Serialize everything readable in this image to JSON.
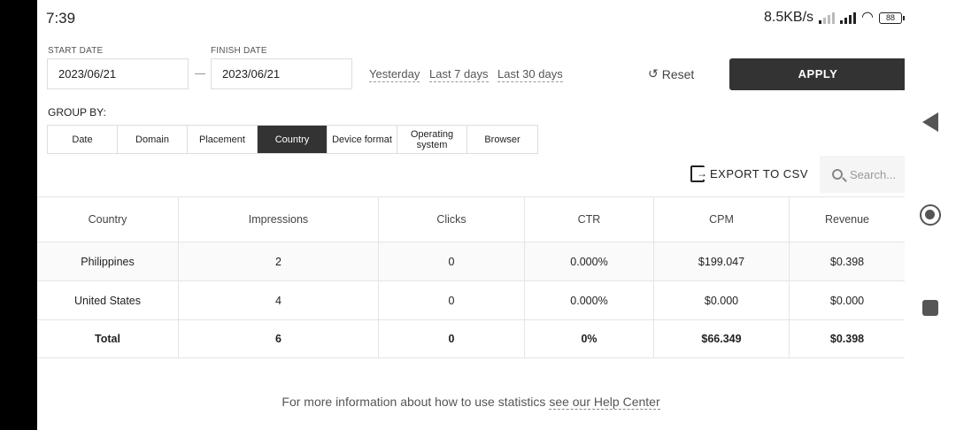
{
  "status_bar": {
    "time": "7:39",
    "network_speed": "8.5KB/s",
    "battery": "88"
  },
  "filters": {
    "start_label": "START DATE",
    "start_value": "2023/06/21",
    "finish_label": "FINISH DATE",
    "finish_value": "2023/06/21",
    "quick_ranges": [
      "Yesterday",
      "Last 7 days",
      "Last 30 days"
    ],
    "reset_label": "Reset",
    "apply_label": "APPLY"
  },
  "group_by": {
    "label": "GROUP BY:",
    "options": [
      "Date",
      "Domain",
      "Placement",
      "Country",
      "Device format",
      "Operating system",
      "Browser"
    ],
    "selected": "Country"
  },
  "toolbar": {
    "export_label": "EXPORT TO CSV",
    "search_placeholder": "Search..."
  },
  "table": {
    "columns": [
      "Country",
      "Impressions",
      "Clicks",
      "CTR",
      "CPM",
      "Revenue"
    ],
    "rows": [
      [
        "Philippines",
        "2",
        "0",
        "0.000%",
        "$199.047",
        "$0.398"
      ],
      [
        "United States",
        "4",
        "0",
        "0.000%",
        "$0.000",
        "$0.000"
      ]
    ],
    "total": [
      "Total",
      "6",
      "0",
      "0%",
      "$66.349",
      "$0.398"
    ]
  },
  "footer": {
    "text": "For more information about how to use statistics ",
    "link": "see our Help Center"
  },
  "colors": {
    "accent": "#333333",
    "border": "#dddddd"
  }
}
